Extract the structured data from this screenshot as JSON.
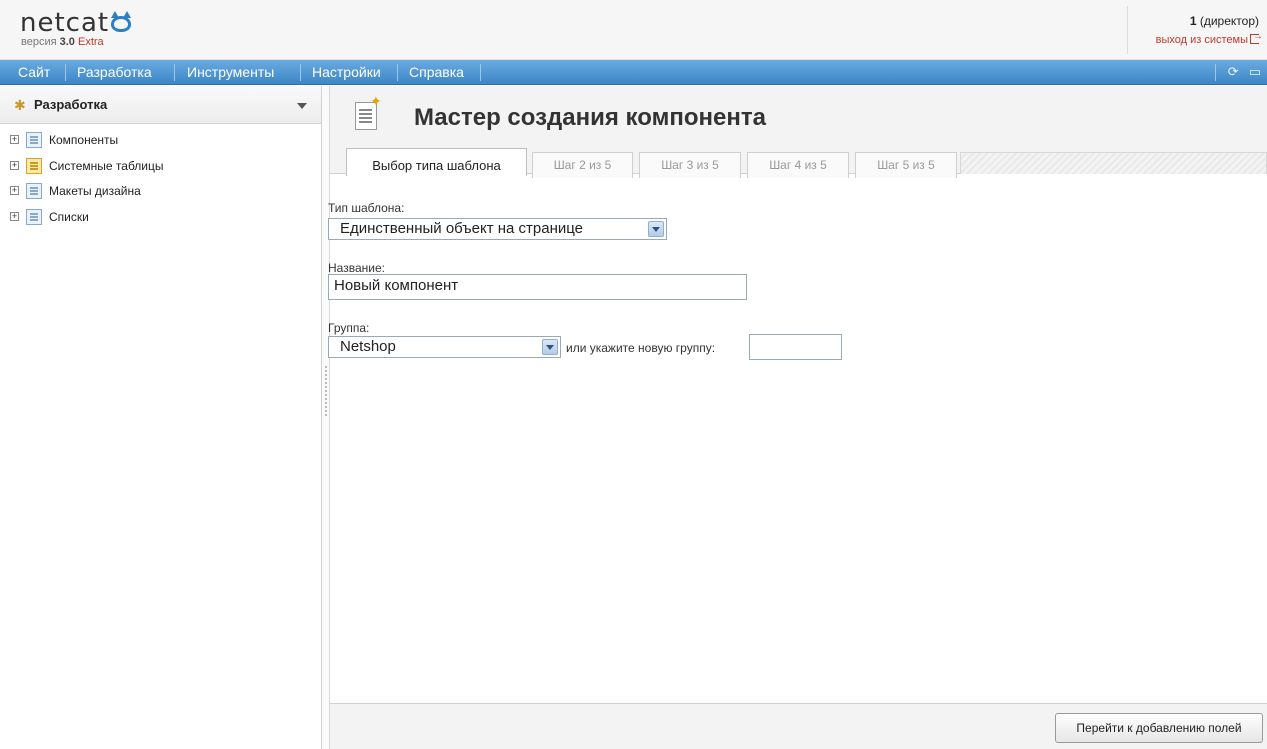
{
  "header": {
    "logo_text": "netcat",
    "version_prefix": "версия",
    "version_number": "3.0",
    "edition": "Extra",
    "user_id": "1",
    "user_role": "(директор)",
    "logout": "выход из системы"
  },
  "menu": {
    "items": [
      "Сайт",
      "Разработка",
      "Инструменты",
      "Настройки",
      "Справка"
    ],
    "tools": [
      "refresh-icon",
      "chat-icon"
    ]
  },
  "sidebar": {
    "title": "Разработка",
    "items": [
      {
        "label": "Компоненты",
        "icon": "component-icon"
      },
      {
        "label": "Системные таблицы",
        "icon": "system-tables-icon"
      },
      {
        "label": "Макеты дизайна",
        "icon": "design-template-icon"
      },
      {
        "label": "Списки",
        "icon": "lists-icon"
      }
    ]
  },
  "main": {
    "title": "Мастер создания компонента",
    "tabs": [
      {
        "label": "Выбор типа шаблона",
        "active": true
      },
      {
        "label": "Шаг 2 из 5",
        "active": false
      },
      {
        "label": "Шаг 3 из 5",
        "active": false
      },
      {
        "label": "Шаг 4 из 5",
        "active": false
      },
      {
        "label": "Шаг 5 из 5",
        "active": false
      }
    ],
    "form": {
      "template_type_label": "Тип шаблона:",
      "template_type_value": "Единственный объект на странице",
      "name_label": "Название:",
      "name_value": "Новый компонент",
      "group_label": "Группа:",
      "group_value": "Netshop",
      "new_group_hint": "или укажите новую группу:",
      "new_group_value": ""
    },
    "next_button": "Перейти к добавлению полей"
  }
}
